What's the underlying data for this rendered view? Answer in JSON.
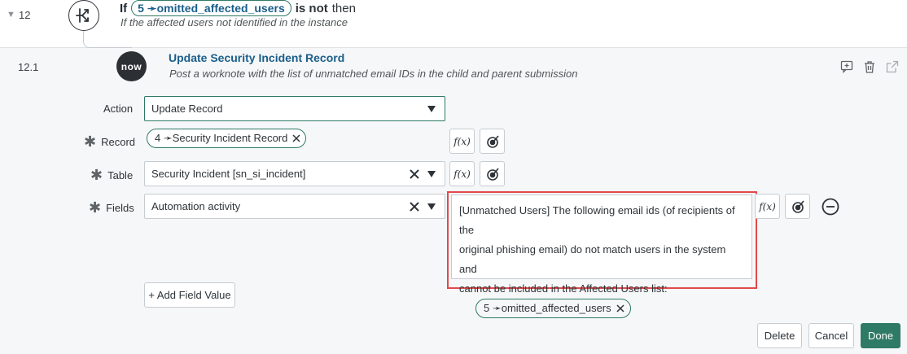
{
  "condition_step": {
    "number": "12",
    "if_keyword": "If",
    "pill": "5 ➛omitted_affected_users",
    "operator": "is not",
    "then_keyword": "then",
    "description": "If the affected users not identified in the instance"
  },
  "action_step": {
    "number": "12.1",
    "logo_text": "now",
    "title": "Update Security Incident Record",
    "description": "Post a worknote with the list of unmatched email IDs in the child and parent submission"
  },
  "form": {
    "action": {
      "label": "Action",
      "value": "Update Record"
    },
    "record": {
      "label": "Record",
      "pill": "4 ➛Security Incident Record"
    },
    "table": {
      "label": "Table",
      "value": "Security Incident [sn_si_incident]"
    },
    "fields": {
      "label": "Fields",
      "value": "Automation activity",
      "text_line1": "[Unmatched Users] The following email ids (of recipients of the",
      "text_line2": "original phishing email) do not match users in the system and",
      "text_line3": "cannot be included in the Affected Users list:",
      "pill": "5 ➛omitted_affected_users"
    },
    "add_field_value": "+ Add Field Value",
    "fx_label": "f(x)"
  },
  "buttons": {
    "delete": "Delete",
    "cancel": "Cancel",
    "done": "Done"
  },
  "colors": {
    "accent": "#2f7a66",
    "link": "#1b5e8a",
    "highlight": "#e2494a"
  }
}
